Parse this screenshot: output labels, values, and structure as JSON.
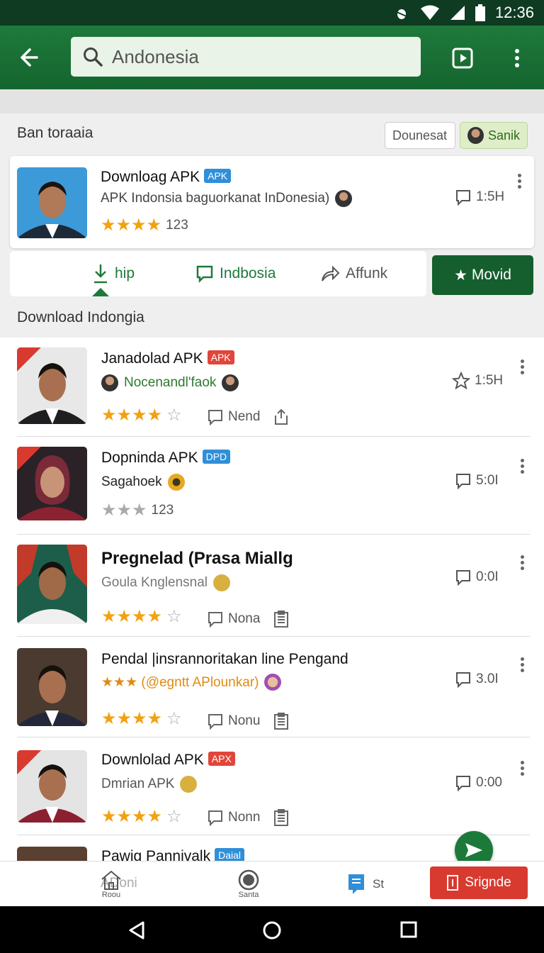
{
  "status_bar": {
    "time": "12:36"
  },
  "app_bar": {
    "search_value": "Andonesia"
  },
  "section": {
    "header": "Ban toraaia",
    "chip_document": "Dounesat",
    "chip_sanik": "Sanik"
  },
  "featured": {
    "title": "Downloag APK",
    "badge": "APK",
    "subtitle": "APK Indonsia baguorkanat InDonesia)",
    "rating_text": "123",
    "stars_on": 4,
    "meta": "1:5H"
  },
  "tabs": [
    {
      "label": "hip",
      "icon": "download-icon"
    },
    {
      "label": "Indbosia",
      "icon": "comment-icon"
    },
    {
      "label": "Affunk",
      "icon": "share-icon"
    }
  ],
  "movid_button": "Movid",
  "list_header": "Download Indongia",
  "items": [
    {
      "title": "Janadolad APK",
      "badge": "APK",
      "badge_color": "red",
      "subtitle": "Nocenandl'faok",
      "sub_style": "green",
      "stars_on": 4,
      "stars_total": 5,
      "action_label": "Nend",
      "meta": "1:5H",
      "meta_icon": "star-outline-icon",
      "portrait": "man"
    },
    {
      "title": "Dopninda APK",
      "badge": "DPD",
      "badge_color": "blue",
      "subtitle": "Sagahoek",
      "sub_style": "dark",
      "stars_on": 3,
      "stars_total": 3,
      "rating_text": "123",
      "meta": "5:0I",
      "meta_icon": "comment-icon",
      "portrait": "woman"
    },
    {
      "title": "Pregnelad (Prasa Miallg",
      "badge": "",
      "subtitle": "Goula Knglensnal",
      "sub_style": "grey",
      "stars_on": 4,
      "stars_total": 5,
      "action_label": "Nona",
      "meta": "0:0I",
      "meta_icon": "comment-icon",
      "portrait": "man2"
    },
    {
      "title": "Pendal |insrannoritakan line Pengand",
      "badge": "",
      "subtitle": "★★★ (@egntt APlounkar)",
      "sub_style": "orange",
      "stars_on": 4,
      "stars_total": 5,
      "action_label": "Nonu",
      "meta": "3.0I",
      "meta_icon": "comment-icon",
      "portrait": "man3"
    },
    {
      "title": "Downlolad APK",
      "badge": "APX",
      "badge_color": "red",
      "subtitle": "Dmrian APK",
      "sub_style": "grey",
      "stars_on": 4,
      "stars_total": 5,
      "action_label": "Nonn",
      "meta": "0:00",
      "meta_icon": "comment-icon",
      "portrait": "man"
    },
    {
      "title": "Pawig Pannivalk",
      "badge": "Daial",
      "badge_color": "blue",
      "subtitle": "",
      "portrait": "man3"
    }
  ],
  "bottom_nav": {
    "left_text": "ADoni",
    "home_label": "Roou",
    "santa_label": "Santa",
    "st_label": "St",
    "signde_button": "Srignde"
  },
  "colors": {
    "primary": "#1e7a3b",
    "accent_red": "#d83a2f",
    "star": "#f2a10f"
  }
}
